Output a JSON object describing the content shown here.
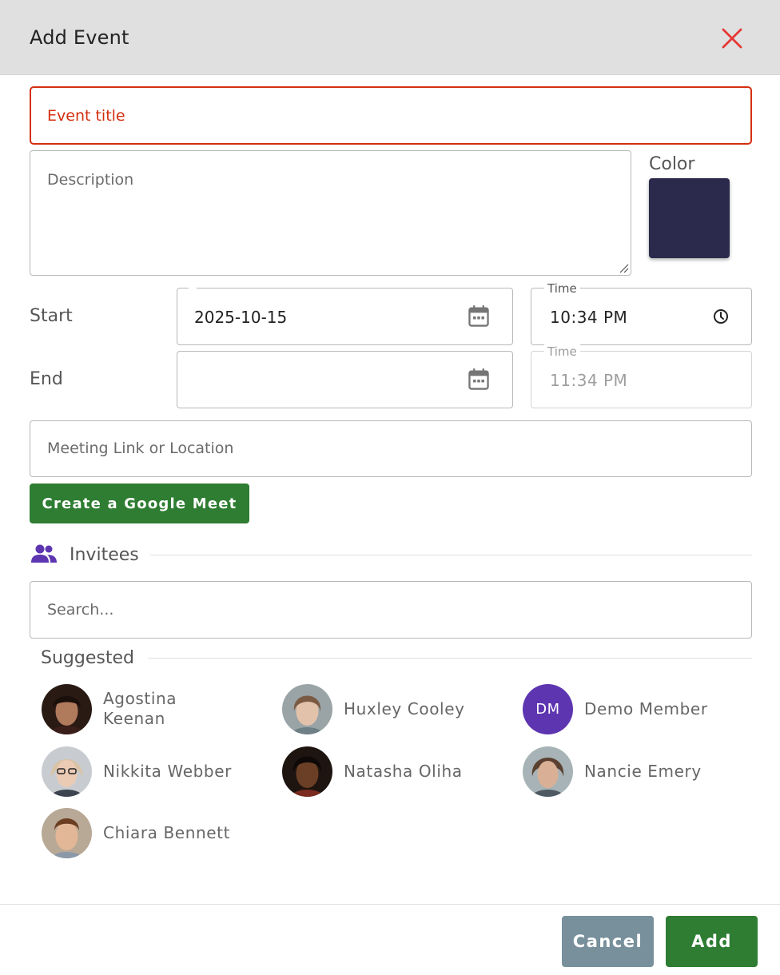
{
  "header": {
    "title": "Add Event"
  },
  "form": {
    "title_placeholder": "Event title",
    "description_placeholder": "Description",
    "color_label": "Color",
    "color_value": "#2b2a4c",
    "start_label": "Start",
    "start_date": "2025-10-15",
    "start_time_legend": "Time",
    "start_time": "10:34 PM",
    "end_label": "End",
    "end_date": "",
    "end_time_legend": "Time",
    "end_time": "11:34 PM",
    "location_placeholder": "Meeting Link or Location",
    "google_meet_button": "Create a Google Meet"
  },
  "invitees": {
    "label": "Invitees",
    "search_placeholder": "Search...",
    "suggested_label": "Suggested",
    "people": [
      {
        "name": "Agostina Keenan",
        "avatar": "photo"
      },
      {
        "name": "Huxley Cooley",
        "avatar": "photo"
      },
      {
        "name": "Demo Member",
        "avatar": "initials",
        "initials": "DM"
      },
      {
        "name": "Nikkita Webber",
        "avatar": "photo"
      },
      {
        "name": "Natasha Oliha",
        "avatar": "photo"
      },
      {
        "name": "Nancie Emery",
        "avatar": "photo"
      },
      {
        "name": "Chiara Bennett",
        "avatar": "photo"
      }
    ]
  },
  "footer": {
    "cancel_label": "Cancel",
    "add_label": "Add"
  },
  "colors": {
    "accent_green": "#2e7d32",
    "error_red": "#d32f0f",
    "cancel_gray": "#78909c",
    "people_icon": "#5e35b1"
  },
  "icons": {
    "close": "close-icon",
    "calendar": "calendar-icon",
    "clock": "clock-icon",
    "people": "people-icon"
  }
}
